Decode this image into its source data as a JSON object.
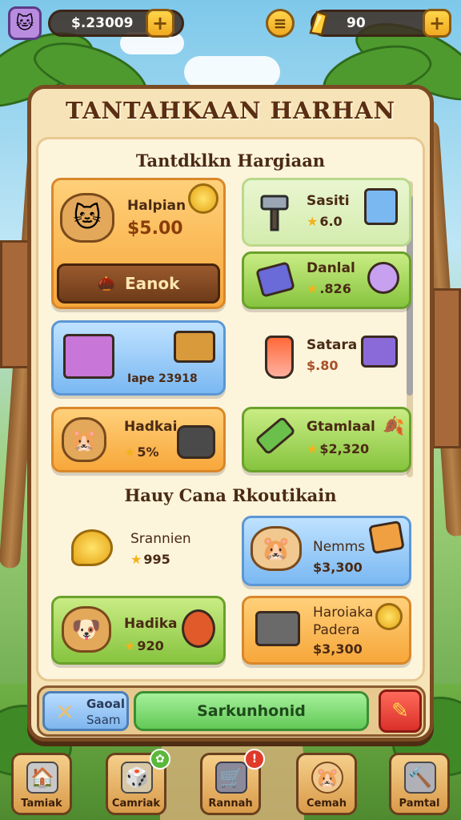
{
  "topbar": {
    "currency_value": "$.23009",
    "gem_value": "90",
    "plus_symbol": "+",
    "menu_symbol": "≡"
  },
  "panel": {
    "title": "TANTAHKAAN HARHAN",
    "section1_title": "Tantdklkn Hargiaan",
    "section2_title": "Hauy Cana Rkoutikain"
  },
  "featured": {
    "name": "Halpian",
    "price": "$5.00",
    "button_label": "Eanok"
  },
  "items": [
    {
      "name": "Sasiti",
      "price": "6.0"
    },
    {
      "name": "Danlal",
      "price": ".826"
    },
    {
      "name": "Iape 23918",
      "price": ""
    },
    {
      "name": "Satara",
      "price": "$.80"
    },
    {
      "name": "Hadkai",
      "price": "5%"
    },
    {
      "name": "Gtamlaal",
      "price": "$2,320"
    }
  ],
  "items2": [
    {
      "name": "Srannien",
      "price": "995"
    },
    {
      "name": "Nemms",
      "price": "$3,300"
    },
    {
      "name": "Hadika",
      "price": "920"
    },
    {
      "name": "Haroiaka",
      "sub": "Padera",
      "price": "$3,300"
    }
  ],
  "action_bar": {
    "tool_label_1": "Gaoal",
    "tool_label_2": "Saam",
    "main_button": "Sarkunhonid"
  },
  "nav": [
    {
      "label": "Tamiak"
    },
    {
      "label": "Camriak"
    },
    {
      "label": "Rannah"
    },
    {
      "label": "Cemah"
    },
    {
      "label": "Pamtal"
    }
  ],
  "colors": {
    "panel_border": "#7a4a22",
    "card_orange": "#f7a73a",
    "card_green": "#86c43e",
    "card_blue": "#7ab8f2",
    "main_button": "#62c956",
    "red_button": "#d9302a"
  }
}
